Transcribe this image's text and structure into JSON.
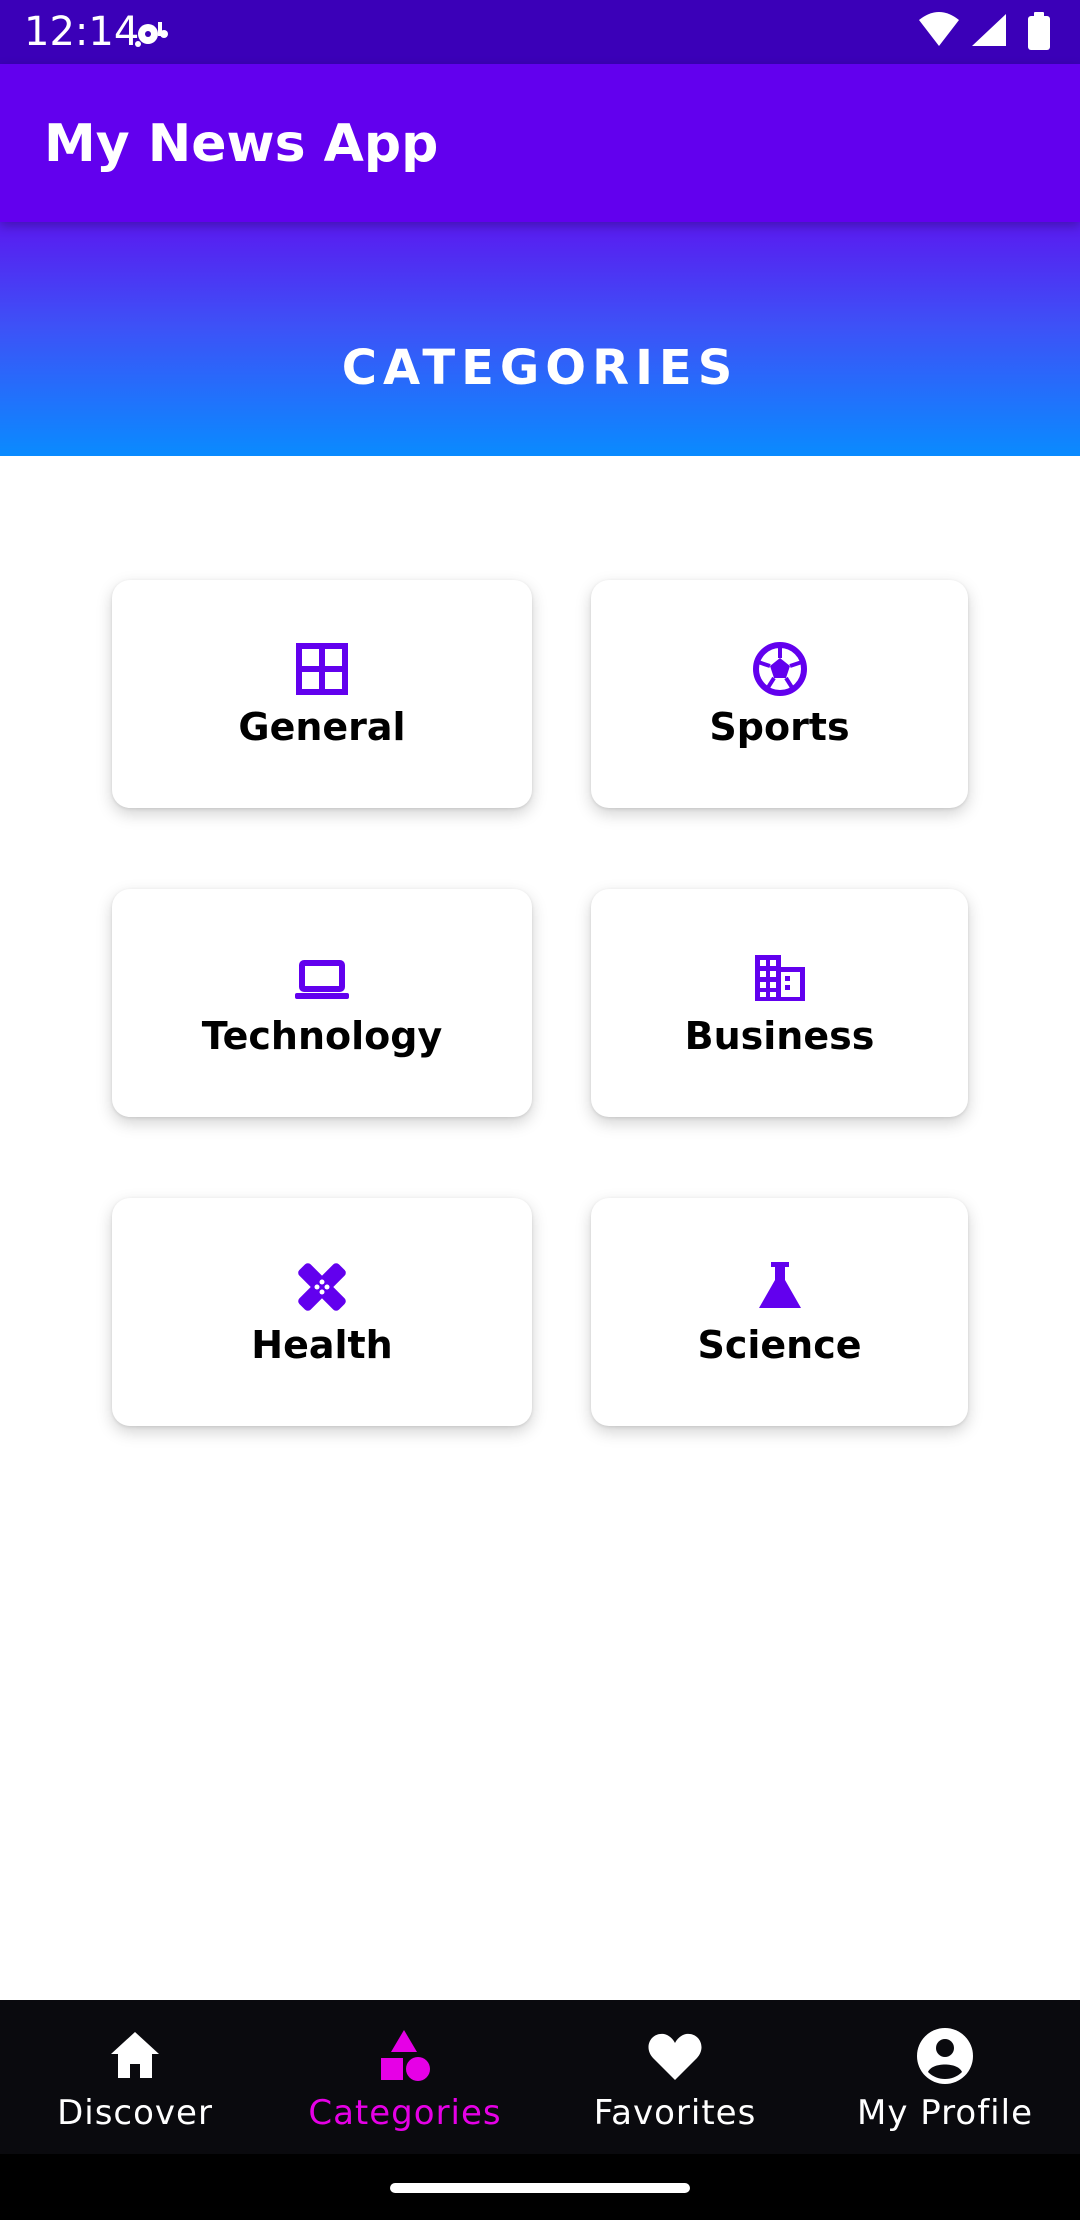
{
  "status_bar": {
    "time": "12:14",
    "icons": [
      "media-notification-icon",
      "wifi-icon",
      "signal-icon",
      "battery-icon"
    ]
  },
  "app_bar": {
    "title": "My News App"
  },
  "hero": {
    "title": "CATEGORIES"
  },
  "categories": [
    {
      "label": "General",
      "icon": "grid-icon"
    },
    {
      "label": "Sports",
      "icon": "soccer-ball-icon"
    },
    {
      "label": "Technology",
      "icon": "laptop-icon"
    },
    {
      "label": "Business",
      "icon": "office-building-icon"
    },
    {
      "label": "Health",
      "icon": "bandage-icon"
    },
    {
      "label": "Science",
      "icon": "flask-icon"
    }
  ],
  "bottom_nav": {
    "items": [
      {
        "label": "Discover",
        "icon": "home-icon",
        "active": false
      },
      {
        "label": "Categories",
        "icon": "category-shapes-icon",
        "active": true
      },
      {
        "label": "Favorites",
        "icon": "heart-icon",
        "active": false
      },
      {
        "label": "My Profile",
        "icon": "account-circle-icon",
        "active": false
      }
    ]
  },
  "colors": {
    "primary": "#6200ee",
    "status_bar": "#3b00b8",
    "hero_gradient_start": "#5a1af0",
    "hero_gradient_end": "#0a8bff",
    "icon_purple": "#6200ee",
    "nav_active": "#e600e6",
    "nav_background": "#0a0a0e"
  }
}
